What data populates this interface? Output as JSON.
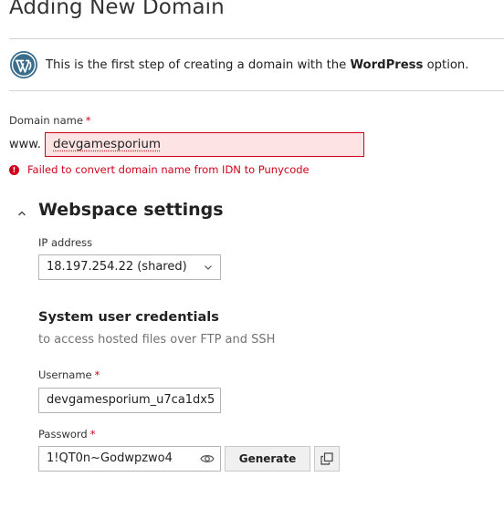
{
  "header": {
    "title": "Adding New Domain"
  },
  "intro": {
    "text_prefix": "This is the first step of creating a domain with the ",
    "text_bold": "WordPress",
    "text_suffix": " option."
  },
  "domain": {
    "label": "Domain name",
    "required_mark": "*",
    "prefix": "www.",
    "value": "devgamesporium",
    "error": "Failed to convert domain name from IDN to Punycode"
  },
  "webspace": {
    "title": "Webspace settings",
    "ip_label": "IP address",
    "ip_value": "18.197.254.22 (shared)"
  },
  "credentials": {
    "title": "System user credentials",
    "description": "to access hosted files over FTP and SSH",
    "username_label": "Username",
    "username_value": "devgamesporium_u7ca1dx5",
    "password_label": "Password",
    "password_value": "1!QT0n~Godwpzwo4",
    "generate_label": "Generate"
  },
  "colors": {
    "error": "#d0021b",
    "error_bg": "#fde3e3",
    "wordpress": "#3a6d8c"
  },
  "icons": [
    "wordpress-logo-icon",
    "error-icon",
    "chevron-up-icon",
    "chevron-down-icon",
    "eye-icon",
    "copy-icon"
  ]
}
